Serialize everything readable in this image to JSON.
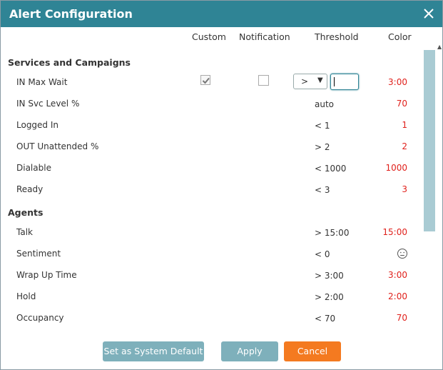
{
  "dialog": {
    "title": "Alert Configuration",
    "close_icon": "close-icon"
  },
  "columns": {
    "custom": "Custom",
    "notification": "Notification",
    "threshold": "Threshold",
    "color": "Color"
  },
  "sections": {
    "services": {
      "title": "Services and Campaigns",
      "rows": [
        {
          "label": "IN Max Wait",
          "threshold": "",
          "color_value": "3:00"
        },
        {
          "label": "IN Svc Level %",
          "threshold": "auto",
          "color_value": "70"
        },
        {
          "label": "Logged In",
          "threshold": "< 1",
          "color_value": "1"
        },
        {
          "label": "OUT Unattended %",
          "threshold": "> 2",
          "color_value": "2"
        },
        {
          "label": "Dialable",
          "threshold": "< 1000",
          "color_value": "1000"
        },
        {
          "label": "Ready",
          "threshold": "< 3",
          "color_value": "3"
        }
      ]
    },
    "agents": {
      "title": "Agents",
      "rows": [
        {
          "label": "Talk",
          "threshold": "> 15:00",
          "color_value": "15:00"
        },
        {
          "label": "Sentiment",
          "threshold": "< 0",
          "color_value": "",
          "icon": "neutral-face-icon"
        },
        {
          "label": "Wrap Up Time",
          "threshold": "> 3:00",
          "color_value": "3:00"
        },
        {
          "label": "Hold",
          "threshold": "> 2:00",
          "color_value": "2:00"
        },
        {
          "label": "Occupancy",
          "threshold": "< 70",
          "color_value": "70"
        }
      ]
    }
  },
  "edit_row": {
    "custom_checked": true,
    "notification_checked": false,
    "operator": ">",
    "operator_arrow": "▼",
    "value": ""
  },
  "buttons": {
    "set_default": "Set as System Default",
    "apply": "Apply",
    "cancel": "Cancel"
  },
  "colors": {
    "header": "#2f8495",
    "alert": "#e0201b",
    "primary_button": "#7eb0bb",
    "cancel_button": "#f47a20"
  }
}
